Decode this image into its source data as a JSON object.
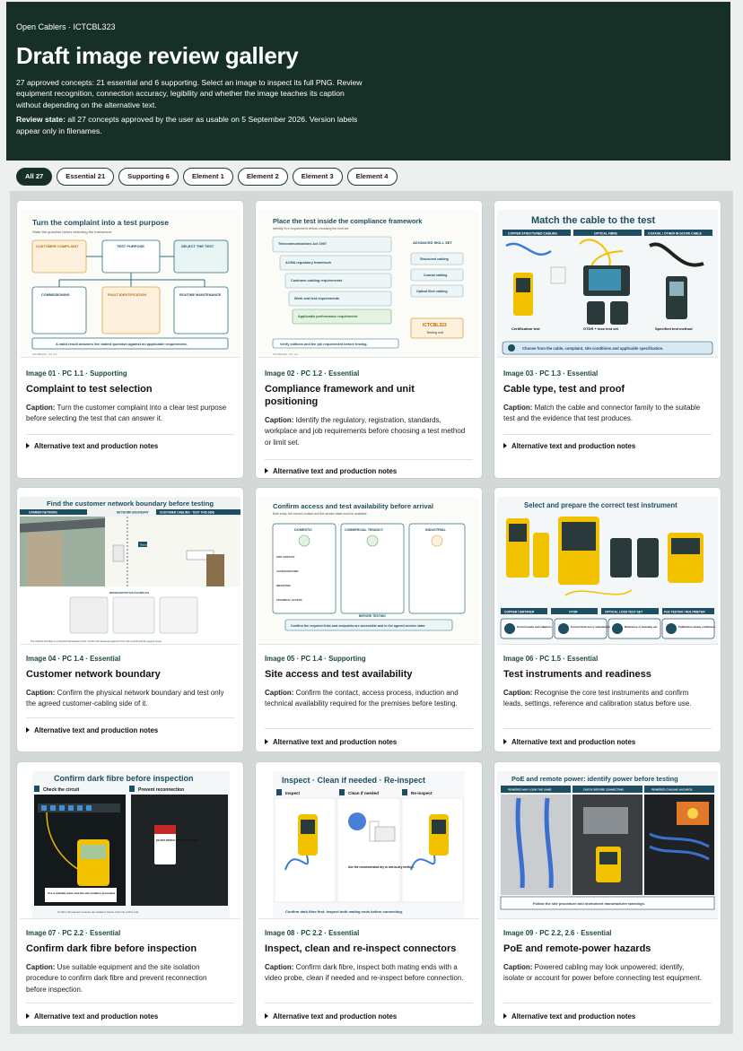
{
  "header": {
    "eyebrow": "Open Cablers · ICTCBL323",
    "title": "Draft image review gallery",
    "intro": "27 approved concepts: 21 essential and 6 supporting. Select an image to inspect its full PNG. Review equipment recognition, connection accuracy, legibility and whether the image teaches its caption without depending on the alternative text.",
    "review_label": "Review state:",
    "review_text": " all 27 concepts approved by the user as usable on 5 September 2026. Version labels appear only in filenames."
  },
  "filters": [
    "All 27",
    "Essential 21",
    "Supporting 6",
    "Element 1",
    "Element 2",
    "Element 3",
    "Element 4"
  ],
  "caption_label": "Caption:",
  "alt_label": "Alternative text and production notes",
  "cards": [
    {
      "meta": "Image 01 · PC 1.1 · Supporting",
      "title": "Complaint to test selection",
      "caption": " Turn the customer complaint into a clear test purpose before selecting the test that can answer it.",
      "thumb": {
        "heading": "Turn the complaint into a test purpose",
        "sub": "State the question before selecting the instrument",
        "box1": "CUSTOMER COMPLAINT",
        "box1_text": "What is happening? Where and when? What changed?",
        "box2": "TEST PURPOSE",
        "box2_text": "Write what the test must determine.",
        "box3": "SELECT THE TEST",
        "box3_text": "Cable + symptom + specification = site",
        "opt1": "COMMISSIONING",
        "opt1_text": "New or upgraded link",
        "opt2": "FAULT IDENTIFICATION",
        "opt2_text": "Faulty or poor performance",
        "opt3": "ROUTINE MAINTENANCE",
        "opt3_text": "Working link / planned check",
        "footer": "A valid result answers the stated question against an applicable requirement.",
        "ref": "ICTCBL323 · PC 1.1"
      }
    },
    {
      "meta": "Image 02 · PC 1.2 · Essential",
      "title": "Compliance framework and unit positioning",
      "caption": " Identify the regulatory, registration, standards, workplace and job requirements before choosing a test method or limit set.",
      "thumb": {
        "heading": "Place the test inside the compliance framework",
        "sub": "Identify th e requirement before choosing the limit set",
        "items": [
          "Telecommunications Act 1997",
          "ACMA regulatory framework",
          "Customer-cabling requirements",
          "Work and test requirements",
          "Applicable performance requirement"
        ],
        "side_title": "ADVANCED SKILL SET",
        "side_items": [
          "Structured cabling",
          "Coaxial cabling",
          "Optical fibre cabling"
        ],
        "unit": "ICTCBL323",
        "unit_text": "Testing unit",
        "footer": "Verify editions and the job requirement before testing.",
        "ref": "ICTCBL323 · PC 1.2"
      }
    },
    {
      "meta": "Image 03 · PC 1.3 · Essential",
      "title": "Cable type, test and proof",
      "caption": " Match the cable and connector family to the suitable test and the evidence that test produces.",
      "thumb": {
        "heading": "Match the cable to the test",
        "cols": [
          "COPPER STRUCTURED CABLING",
          "OPTICAL FIBRE",
          "COAXIAL / OTHER IN-SCOPE CABLE"
        ],
        "tests": [
          "Certification test",
          "OTDR + loss test set",
          "Specified test method"
        ],
        "footer": "Choose from the cable, complaint, site conditions and applicable specification."
      }
    },
    {
      "meta": "Image 04 · PC 1.4 · Essential",
      "title": "Customer network boundary",
      "caption": " Confirm the physical network boundary and test only the agreed customer-cabling side of it.",
      "thumb": {
        "heading": "Find the customer network boundary before testing",
        "left": "CARRIER NETWORK",
        "mid": "NETWORK BOUNDARY",
        "right": "CUSTOMER CABLING - TEST THIS SIDE",
        "tag": "Test scope",
        "examples": "REPRESENTATIVE EXAMPLES",
        "footer": "The network boundary is a physical demarcation point. Confirm the actual arrangement from site records and the agreed scope."
      }
    },
    {
      "meta": "Image 05 · PC 1.4 · Supporting",
      "title": "Site access and test availability",
      "caption": " Confirm the contact, access process, induction and technical availability required for the premises before testing.",
      "thumb": {
        "heading": "Confirm access and test availability before arrival",
        "sub": "Both ends, the correct contact and the service state must be available",
        "cols": [
          "DOMESTIC",
          "COMMERCIAL TENANCY",
          "INDUSTRIAL"
        ],
        "rows": [
          "SITE CONTACT",
          "ACCESS RECORD",
          "INDUCTION",
          "TECHNICAL ACCESS"
        ],
        "before": "BEFORE TESTING",
        "footer": "Confirm the required links and endpoints are accessible and in the agreed service state."
      }
    },
    {
      "meta": "Image 06 · PC 1.5 · Essential",
      "title": "Test instruments and readiness",
      "caption": " Recognise the core test instruments and confirm leads, settings, reference and calibration status before use.",
      "thumb": {
        "heading": "Select and prepare the correct test instrument",
        "labels": [
          "COPPER CERTIFIER",
          "OTDR",
          "OPTICAL LOSS TEST SET",
          "PoE TESTER / MULTIMETER"
        ],
        "steps": [
          "Correct leads and adaptors",
          "Correct limit set or wavelength",
          "Reference or baseline set",
          "Calibration status confirmed"
        ]
      }
    },
    {
      "meta": "Image 07 · PC 2.2 · Essential",
      "title": "Confirm dark fibre before inspection",
      "caption": " Use suitable equipment and the site isolation procedure to confirm dark fibre and prevent reconnection before inspection.",
      "thumb": {
        "heading": "Confirm dark fibre before inspection",
        "step1": "Check the circuit",
        "step2": "Prevent reconnection",
        "tag": "DO NOT SWITCH ON OR RECONNECT",
        "note": "Use a suitable meter and the site isolation procedure",
        "footer": "Confirm all relevant sources are isolated. Never look into a fibre end."
      }
    },
    {
      "meta": "Image 08 · PC 2.2 · Essential",
      "title": "Inspect, clean and re-inspect connectors",
      "caption": " Confirm dark fibre, inspect both mating ends with a video probe, clean if needed and re-inspect before connection.",
      "thumb": {
        "heading": "Inspect · Clean if needed · Re-inspect",
        "steps": [
          "Inspect",
          "Clean if needed",
          "Re-inspect"
        ],
        "note": "Use the recommended dry or wet-to-dry method.",
        "footer": "Confirm dark fibre first. Inspect both mating ends before connecting."
      }
    },
    {
      "meta": "Image 09 · PC 2.2, 2.6 · Essential",
      "title": "PoE and remote-power hazards",
      "caption": " Powered cabling may look unpowered; identify, isolate or account for power before connecting test equipment.",
      "thumb": {
        "heading": "PoE and remote power: identify power before testing",
        "panels": [
          "POWERED MAY LOOK THE SAME",
          "CHECK BEFORE CONNECTING",
          "POWERED CABLING HAZARDS"
        ],
        "footer": "Follow the site procedure and instrument manufacturer warnings."
      }
    }
  ]
}
